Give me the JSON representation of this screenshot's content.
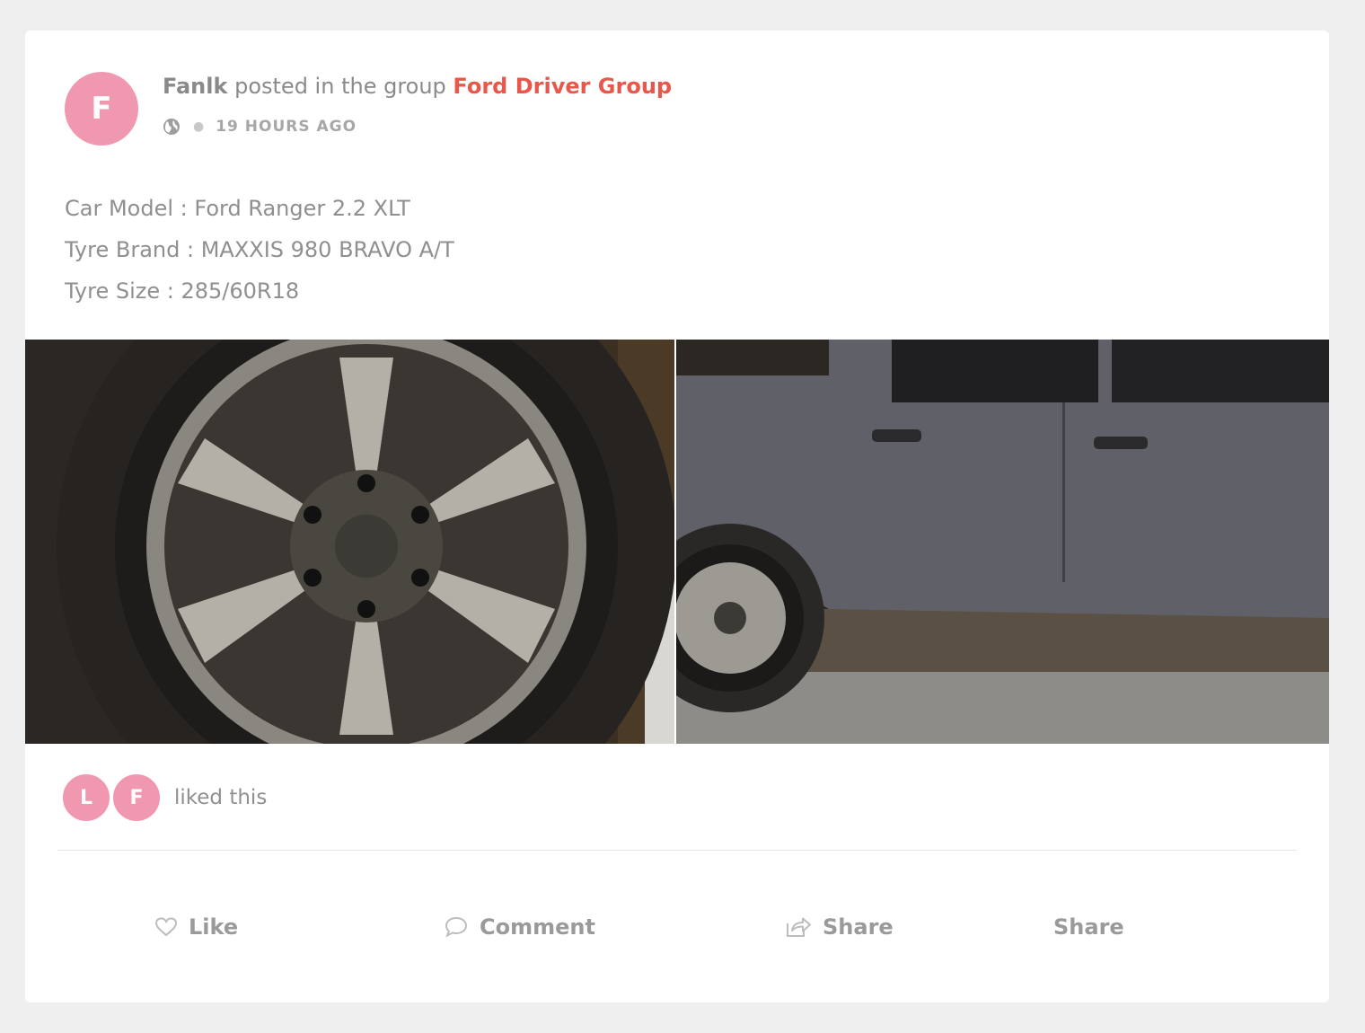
{
  "post": {
    "avatar_letter": "F",
    "author": "Fanlk",
    "posted_in_text": " posted in the group ",
    "group": "Ford Driver Group",
    "privacy_icon": "globe-icon",
    "time": "19 HOURS AGO",
    "body_lines": [
      "Car Model : Ford Ranger 2.2 XLT",
      "Tyre Brand : MAXXIS 980 BRAVO A/T",
      "Tyre Size : 285/60R18"
    ]
  },
  "likes": {
    "avatars": [
      "L",
      "F"
    ],
    "text": "liked this"
  },
  "actions": {
    "like": "Like",
    "comment": "Comment",
    "share": "Share",
    "share2": "Share"
  },
  "colors": {
    "accent": "#e9574b",
    "avatar": "#f198b1",
    "text": "#8f8f8f",
    "background": "#efefef"
  }
}
